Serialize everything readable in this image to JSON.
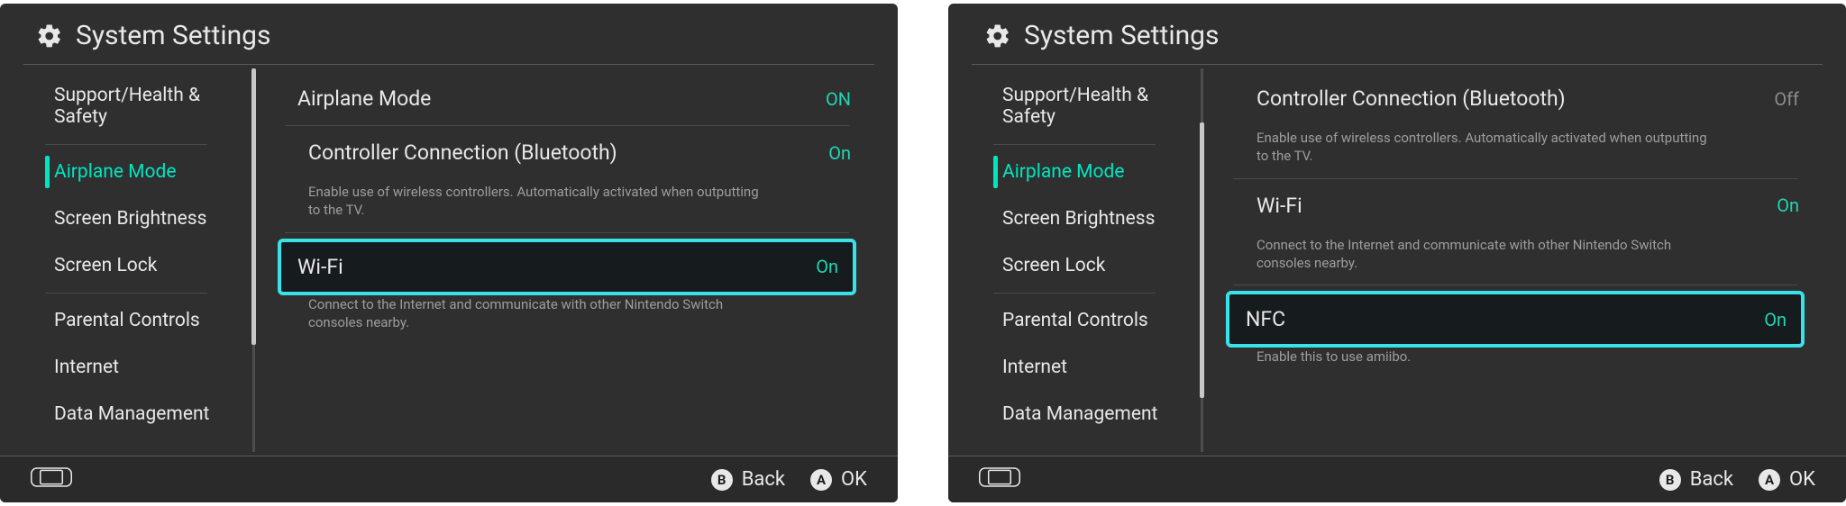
{
  "screens": [
    {
      "title": "System Settings",
      "scroll_thumb": {
        "top_pct": 0,
        "height_pct": 72
      },
      "sidebar": [
        {
          "label": "Support/Health & Safety",
          "selected": false,
          "sep_after": true
        },
        {
          "label": "Airplane Mode",
          "selected": true,
          "sep_after": false
        },
        {
          "label": "Screen Brightness",
          "selected": false,
          "sep_after": false
        },
        {
          "label": "Screen Lock",
          "selected": false,
          "sep_after": true
        },
        {
          "label": "Parental Controls",
          "selected": false,
          "sep_after": false
        },
        {
          "label": "Internet",
          "selected": false,
          "sep_after": false
        },
        {
          "label": "Data Management",
          "selected": false,
          "sep_after": false
        }
      ],
      "rows": [
        {
          "kind": "row",
          "label": "Airplane Mode",
          "value": "ON",
          "value_kind": "on",
          "sub": false
        },
        {
          "kind": "sep"
        },
        {
          "kind": "row",
          "label": "Controller Connection (Bluetooth)",
          "value": "On",
          "value_kind": "on",
          "sub": true
        },
        {
          "kind": "desc",
          "text": "Enable use of wireless controllers. Automatically activated when outputting to the TV."
        },
        {
          "kind": "sep"
        },
        {
          "kind": "gap"
        },
        {
          "kind": "row_hl",
          "label": "Wi-Fi",
          "value": "On",
          "value_kind": "on"
        },
        {
          "kind": "desc",
          "text": "Connect to the Internet and communicate with other Nintendo Switch consoles nearby."
        }
      ],
      "footer": {
        "back_glyph": "B",
        "back_label": "Back",
        "ok_glyph": "A",
        "ok_label": "OK"
      }
    },
    {
      "title": "System Settings",
      "scroll_thumb": {
        "top_pct": 14,
        "height_pct": 72
      },
      "sidebar": [
        {
          "label": "Support/Health & Safety",
          "selected": false,
          "sep_after": true
        },
        {
          "label": "Airplane Mode",
          "selected": true,
          "sep_after": false
        },
        {
          "label": "Screen Brightness",
          "selected": false,
          "sep_after": false
        },
        {
          "label": "Screen Lock",
          "selected": false,
          "sep_after": true
        },
        {
          "label": "Parental Controls",
          "selected": false,
          "sep_after": false
        },
        {
          "label": "Internet",
          "selected": false,
          "sep_after": false
        },
        {
          "label": "Data Management",
          "selected": false,
          "sep_after": false
        }
      ],
      "rows": [
        {
          "kind": "row",
          "label": "Controller Connection (Bluetooth)",
          "value": "Off",
          "value_kind": "off",
          "sub": true
        },
        {
          "kind": "desc",
          "text": "Enable use of wireless controllers. Automatically activated when outputting to the TV."
        },
        {
          "kind": "sep"
        },
        {
          "kind": "row",
          "label": "Wi-Fi",
          "value": "On",
          "value_kind": "on",
          "sub": true
        },
        {
          "kind": "desc",
          "text": "Connect to the Internet and communicate with other Nintendo Switch consoles nearby."
        },
        {
          "kind": "sep"
        },
        {
          "kind": "gap"
        },
        {
          "kind": "row_hl",
          "label": "NFC",
          "value": "On",
          "value_kind": "on"
        },
        {
          "kind": "desc",
          "text": "Enable this to use amiibo."
        }
      ],
      "footer": {
        "back_glyph": "B",
        "back_label": "Back",
        "ok_glyph": "A",
        "ok_label": "OK"
      }
    }
  ]
}
